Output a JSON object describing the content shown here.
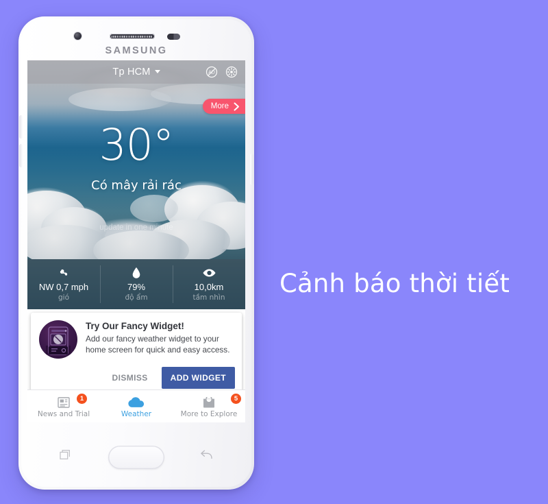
{
  "tagline": "Cảnh báo thời tiết",
  "phone": {
    "brand": "SAMSUNG",
    "hardware": {
      "camera": "front-camera",
      "speaker": "earpiece-speaker",
      "sensor": "proximity-sensor",
      "volume_up": "volume-up-button",
      "volume_down": "volume-down-button",
      "power": "power-button",
      "home": "home-button",
      "recents": "recents-key",
      "back": "back-key"
    }
  },
  "app": {
    "topbar": {
      "city": "Tp HCM",
      "dropdown_icon": "chevron-down-icon",
      "icons": [
        {
          "name": "no-ads-icon"
        },
        {
          "name": "gear-icon"
        }
      ]
    },
    "hero": {
      "more_label": "More",
      "more_icon": "chevron-right-icon",
      "more_color": "#f8556d",
      "temperature": "30°",
      "condition": "Có mây rải rác",
      "updated": "update in one minute"
    },
    "stats": [
      {
        "icon": "wind-pinwheel-icon",
        "value": "NW 0,7 mph",
        "label": "gió"
      },
      {
        "icon": "water-drop-icon",
        "value": "79%",
        "label": "độ ẩm"
      },
      {
        "icon": "eye-icon",
        "value": "10,0km",
        "label": "tầm nhìn"
      }
    ],
    "widget_card": {
      "art_icon": "phone-widget-illustration",
      "title": "Try Our Fancy Widget!",
      "body": "Add our fancy weather widget to your home screen for quick and easy access.",
      "dismiss_label": "DISMISS",
      "add_label": "ADD WIDGET",
      "add_color": "#3f5ba4"
    },
    "nav": {
      "items": [
        {
          "icon": "news-icon",
          "label": "News and Trial",
          "badge": "1",
          "active": false
        },
        {
          "icon": "cloud-icon",
          "label": "Weather",
          "badge": "",
          "active": true
        },
        {
          "icon": "explore-bag-icon",
          "label": "More to Explore",
          "badge": "5",
          "active": false
        }
      ],
      "badge_color": "#f4511e",
      "active_color": "#3ca0e0"
    }
  },
  "theme": {
    "background": "#8a86fb"
  }
}
